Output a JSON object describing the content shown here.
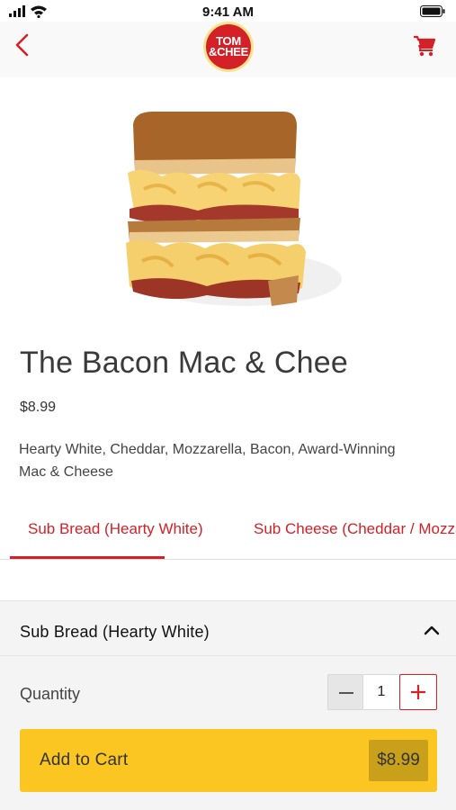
{
  "status_bar": {
    "time": "9:41 AM"
  },
  "header": {
    "logo_line1": "TOM",
    "logo_line2": "&CHEE"
  },
  "product": {
    "title": "The Bacon Mac & Chee",
    "price": "$8.99",
    "description": "Hearty White, Cheddar, Mozzarella, Bacon, Award-Winning Mac & Cheese"
  },
  "tabs": [
    {
      "label": "Sub Bread (Hearty White)",
      "active": true
    },
    {
      "label": "Sub Cheese (Cheddar / Mozzarella)",
      "active": false
    }
  ],
  "section": {
    "title": "Sub Bread (Hearty White)"
  },
  "quantity": {
    "label": "Quantity",
    "value": "1"
  },
  "cart_button": {
    "label": "Add to Cart",
    "price": "$8.99"
  },
  "colors": {
    "brand_red": "#d32127",
    "cta_yellow": "#fbc622",
    "price_chip": "#c9a019"
  }
}
